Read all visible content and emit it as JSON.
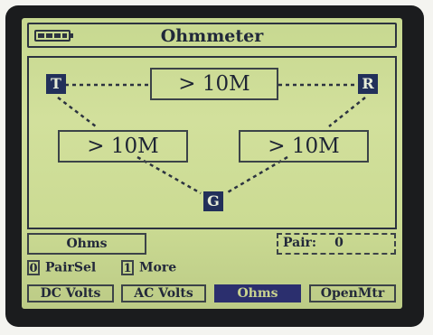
{
  "app": {
    "title": "Ohmmeter"
  },
  "battery": {
    "icon": "battery-full-icon",
    "level": 1.0
  },
  "nodes": {
    "t": "T",
    "r": "R",
    "g": "G"
  },
  "readings": {
    "tr": "> 10M",
    "tg": "> 10M",
    "rg": "> 10M"
  },
  "status": {
    "mode": "Ohms",
    "pair_label": "Pair:",
    "pair_value": "0"
  },
  "keys": [
    {
      "key": "0",
      "label": "PairSel"
    },
    {
      "key": "1",
      "label": "More"
    }
  ],
  "softkeys": [
    {
      "label": "DC Volts"
    },
    {
      "label": "AC Volts"
    },
    {
      "label": "Ohms",
      "active": true
    },
    {
      "label": "OpenMtr"
    }
  ],
  "colors": {
    "screen": "#cbdb93",
    "ink": "#22283a",
    "node": "#22305a",
    "active": "#2b2f6e"
  }
}
